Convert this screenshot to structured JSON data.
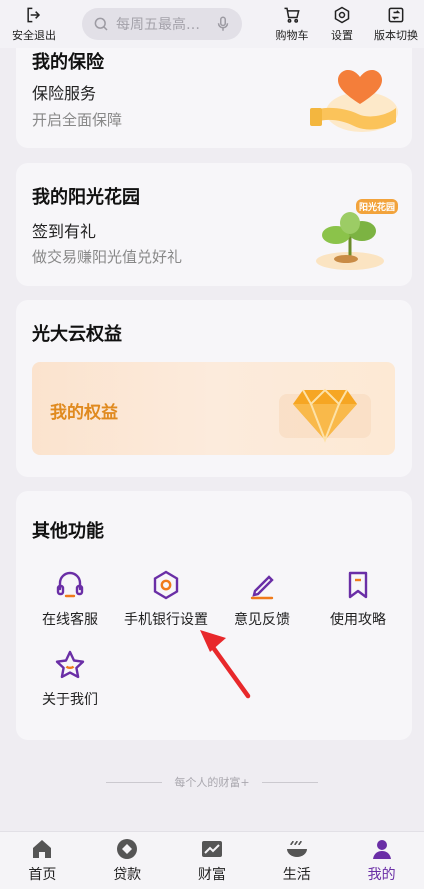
{
  "topbar": {
    "logout_label": "安全退出",
    "search_placeholder": "每周五最高…",
    "cart_label": "购物车",
    "settings_label": "设置",
    "switch_label": "版本切换"
  },
  "insurance_card": {
    "title": "我的保险",
    "subtitle": "保险服务",
    "desc": "开启全面保障"
  },
  "garden_card": {
    "title": "我的阳光花园",
    "subtitle": "签到有礼",
    "desc": "做交易赚阳光值兑好礼",
    "badge": "阳光花园"
  },
  "cloud_card": {
    "title": "光大云权益",
    "banner_label": "我的权益"
  },
  "functions_card": {
    "title": "其他功能",
    "items": [
      {
        "label": "在线客服",
        "icon": "headset-icon"
      },
      {
        "label": "手机银行设置",
        "icon": "hexagon-settings-icon"
      },
      {
        "label": "意见反馈",
        "icon": "pencil-icon"
      },
      {
        "label": "使用攻略",
        "icon": "bookmark-icon"
      },
      {
        "label": "关于我们",
        "icon": "star-face-icon"
      }
    ]
  },
  "tagline": "每个人的财富+",
  "bottom_nav": {
    "items": [
      {
        "label": "首页",
        "icon": "home-icon"
      },
      {
        "label": "贷款",
        "icon": "loan-icon"
      },
      {
        "label": "财富",
        "icon": "chart-icon"
      },
      {
        "label": "生活",
        "icon": "bowl-icon"
      },
      {
        "label": "我的",
        "icon": "user-icon"
      }
    ],
    "active": "我的"
  },
  "colors": {
    "accent_purple": "#6a2ea6",
    "accent_orange": "#f07a1a",
    "equity_gold": "#e08a1f"
  }
}
